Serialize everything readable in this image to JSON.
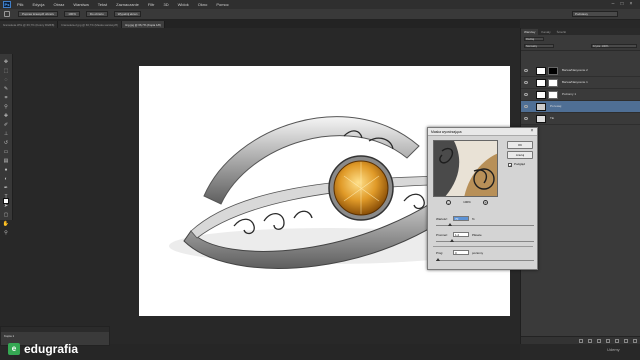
{
  "menubar": {
    "app_logo": "Ps",
    "items": [
      "Plik",
      "Edycja",
      "Obraz",
      "Warstwa",
      "Tekst",
      "Zaznaczanie",
      "Filtr",
      "3D",
      "Widok",
      "Okno",
      "Pomoc"
    ]
  },
  "optionsbar": {
    "buttons": [
      "Popraw krawędź obrazu",
      "100%",
      "Do obrazu",
      "Wypełnij ekran"
    ],
    "workspace": "Podstawy"
  },
  "tabs": [
    "bransoleta.JPG @ 66,7% (Kolory RGB/8)",
    "bransoleta-2.jpg @ 66,7% (Maska warstwy/8)",
    "ring.jpg @ 66,7% (Kopia 1/8)"
  ],
  "layers_panel": {
    "tabs": [
      "Warstwy",
      "Kanały",
      "Ścieżki"
    ],
    "kind_filter": "Rodzaj",
    "blend_mode": "Normalny",
    "opacity_label": "Krycie: 100%",
    "fill_label": "Wypełnienie: 100%",
    "layers": [
      {
        "name": "Barwa/Nasycenie 2",
        "selected": false
      },
      {
        "name": "Barwa/Nasycenie 1",
        "selected": false
      },
      {
        "name": "Poziomy 1",
        "selected": false
      },
      {
        "name": "Po lewej",
        "selected": true
      },
      {
        "name": "Tło",
        "selected": false
      }
    ]
  },
  "dialog": {
    "title": "Maska wyostrzająca",
    "ok": "OK",
    "reset": "Anuluj",
    "preview_label": "Podgląd",
    "preview_checked": true,
    "zoom": "100%",
    "amount_label": "Wartość:",
    "amount_value": "70",
    "amount_unit": "%",
    "radius_label": "Promień:",
    "radius_value": "1,2",
    "radius_unit": "Piksele",
    "threshold_label": "Próg:",
    "threshold_value": "0",
    "threshold_unit": "poziomy"
  },
  "mini_panel": {
    "row": "Kopia 1"
  },
  "brand": {
    "logo": "e",
    "name": "edugrafia"
  },
  "watermark": "Udemy"
}
